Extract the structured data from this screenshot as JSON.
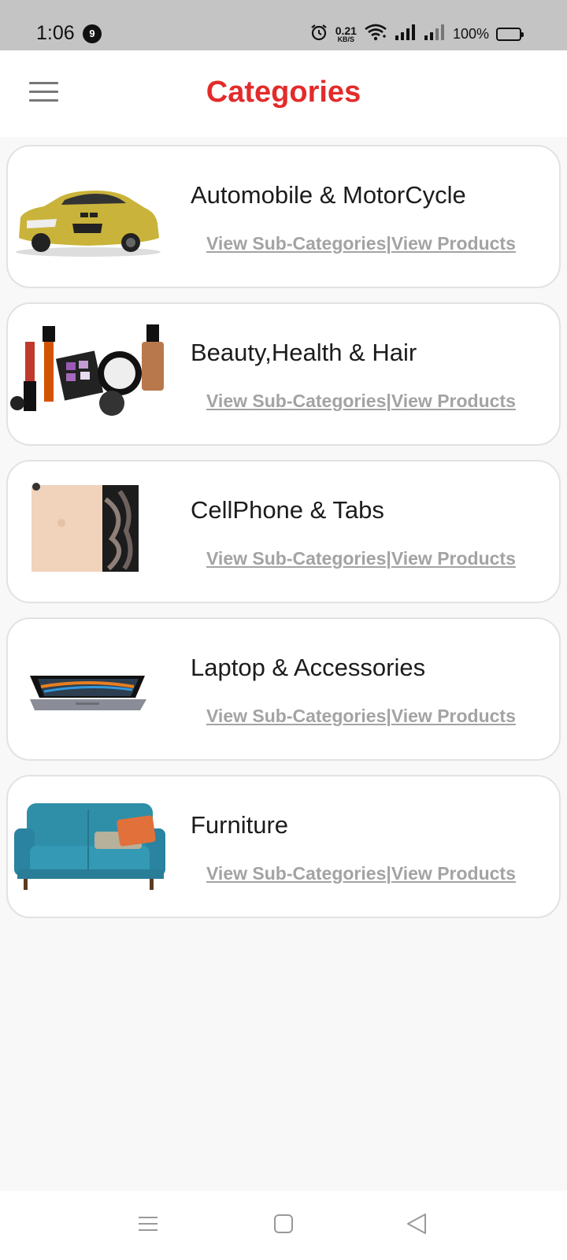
{
  "status_bar": {
    "time": "1:06",
    "notification_count": "9",
    "net_speed_value": "0.21",
    "net_speed_unit": "KB/S",
    "battery_percent": "100%"
  },
  "header": {
    "title": "Categories",
    "title_color": "#e32b2b"
  },
  "categories": [
    {
      "name": "Automobile & MotorCycle",
      "image": "car-image",
      "link_subcategories": "View Sub-Categories",
      "separator": "|",
      "link_products": "View Products"
    },
    {
      "name": "Beauty,Health & Hair",
      "image": "cosmetics-image",
      "link_subcategories": "View Sub-Categories",
      "separator": "|",
      "link_products": "View Products"
    },
    {
      "name": "CellPhone & Tabs",
      "image": "smartphone-image",
      "link_subcategories": "View Sub-Categories",
      "separator": "|",
      "link_products": "View Products"
    },
    {
      "name": "Laptop & Accessories",
      "image": "laptop-image",
      "link_subcategories": "View Sub-Categories",
      "separator": "|",
      "link_products": "View Products"
    },
    {
      "name": "Furniture",
      "image": "sofa-image",
      "link_subcategories": "View Sub-Categories",
      "separator": "|",
      "link_products": "View Products"
    }
  ],
  "nav_bar": {
    "icons": [
      "recent-apps-icon",
      "home-icon",
      "back-icon"
    ]
  }
}
